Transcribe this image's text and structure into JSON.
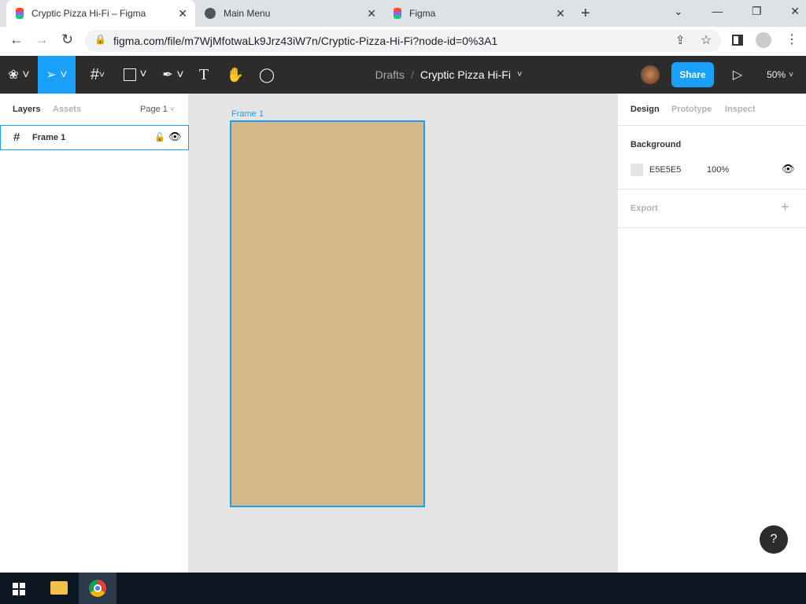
{
  "browser": {
    "tabs": [
      {
        "title": "Cryptic Pizza Hi-Fi – Figma"
      },
      {
        "title": "Main Menu"
      },
      {
        "title": "Figma"
      }
    ],
    "url": "figma.com/file/m7WjMfotwaLk9Jrz43iW7n/Cryptic-Pizza-Hi-Fi?node-id=0%3A1"
  },
  "toolbar": {
    "breadcrumb_parent": "Drafts",
    "separator": "/",
    "file_name": "Cryptic Pizza Hi-Fi",
    "share_label": "Share",
    "zoom": "50%"
  },
  "left_panel": {
    "tabs": [
      "Layers",
      "Assets"
    ],
    "page": "Page 1",
    "layers": [
      {
        "name": "Frame 1"
      }
    ]
  },
  "canvas": {
    "frame_label": "Frame 1",
    "frame_color": "#d7b889"
  },
  "right_panel": {
    "tabs": [
      "Design",
      "Prototype",
      "Inspect"
    ],
    "background_title": "Background",
    "bg_hex": "E5E5E5",
    "bg_opacity": "100%",
    "export_title": "Export"
  },
  "help": "?"
}
